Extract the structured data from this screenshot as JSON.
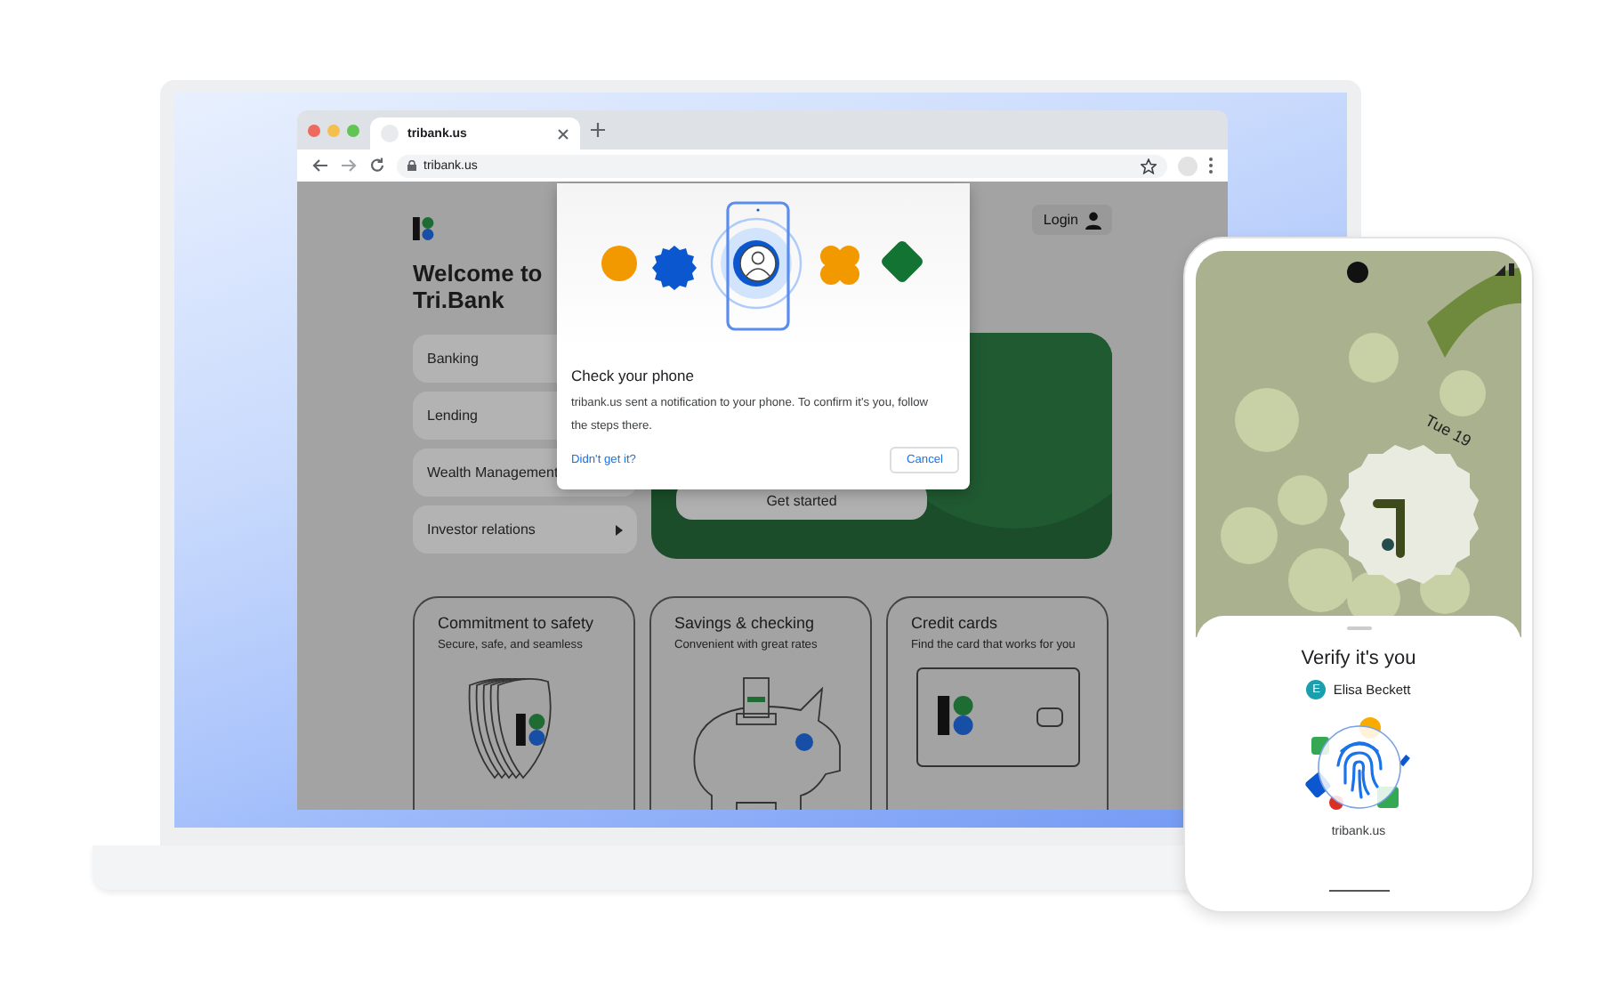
{
  "browser": {
    "tab_title": "tribank.us",
    "url": "tribank.us"
  },
  "page": {
    "heading": "Welcome to Tri.Bank",
    "login": "Login",
    "nav": [
      {
        "label": "Banking"
      },
      {
        "label": "Lending"
      },
      {
        "label": "Wealth Management"
      },
      {
        "label": "Investor relations",
        "has_submenu": true
      }
    ],
    "hero": {
      "button": "Get started"
    },
    "cards": [
      {
        "kind": "shield",
        "title": "Commitment to safety",
        "subtitle": "Secure, safe, and seamless"
      },
      {
        "kind": "piggy",
        "title": "Savings & checking",
        "subtitle": "Convenient with great rates"
      },
      {
        "kind": "card",
        "title": "Credit cards",
        "subtitle": "Find the card that works for you"
      }
    ]
  },
  "dialog": {
    "title": "Check your phone",
    "body": "tribank.us sent a notification to your phone. To confirm it's you, follow the steps there.",
    "link": "Didn't get it?",
    "cancel": "Cancel"
  },
  "phone": {
    "date": "Tue 19",
    "sheet_title": "Verify it's you",
    "account": {
      "initial": "E",
      "name": "Elisa Beckett",
      "color": "#1a9fae"
    },
    "site": "tribank.us"
  }
}
